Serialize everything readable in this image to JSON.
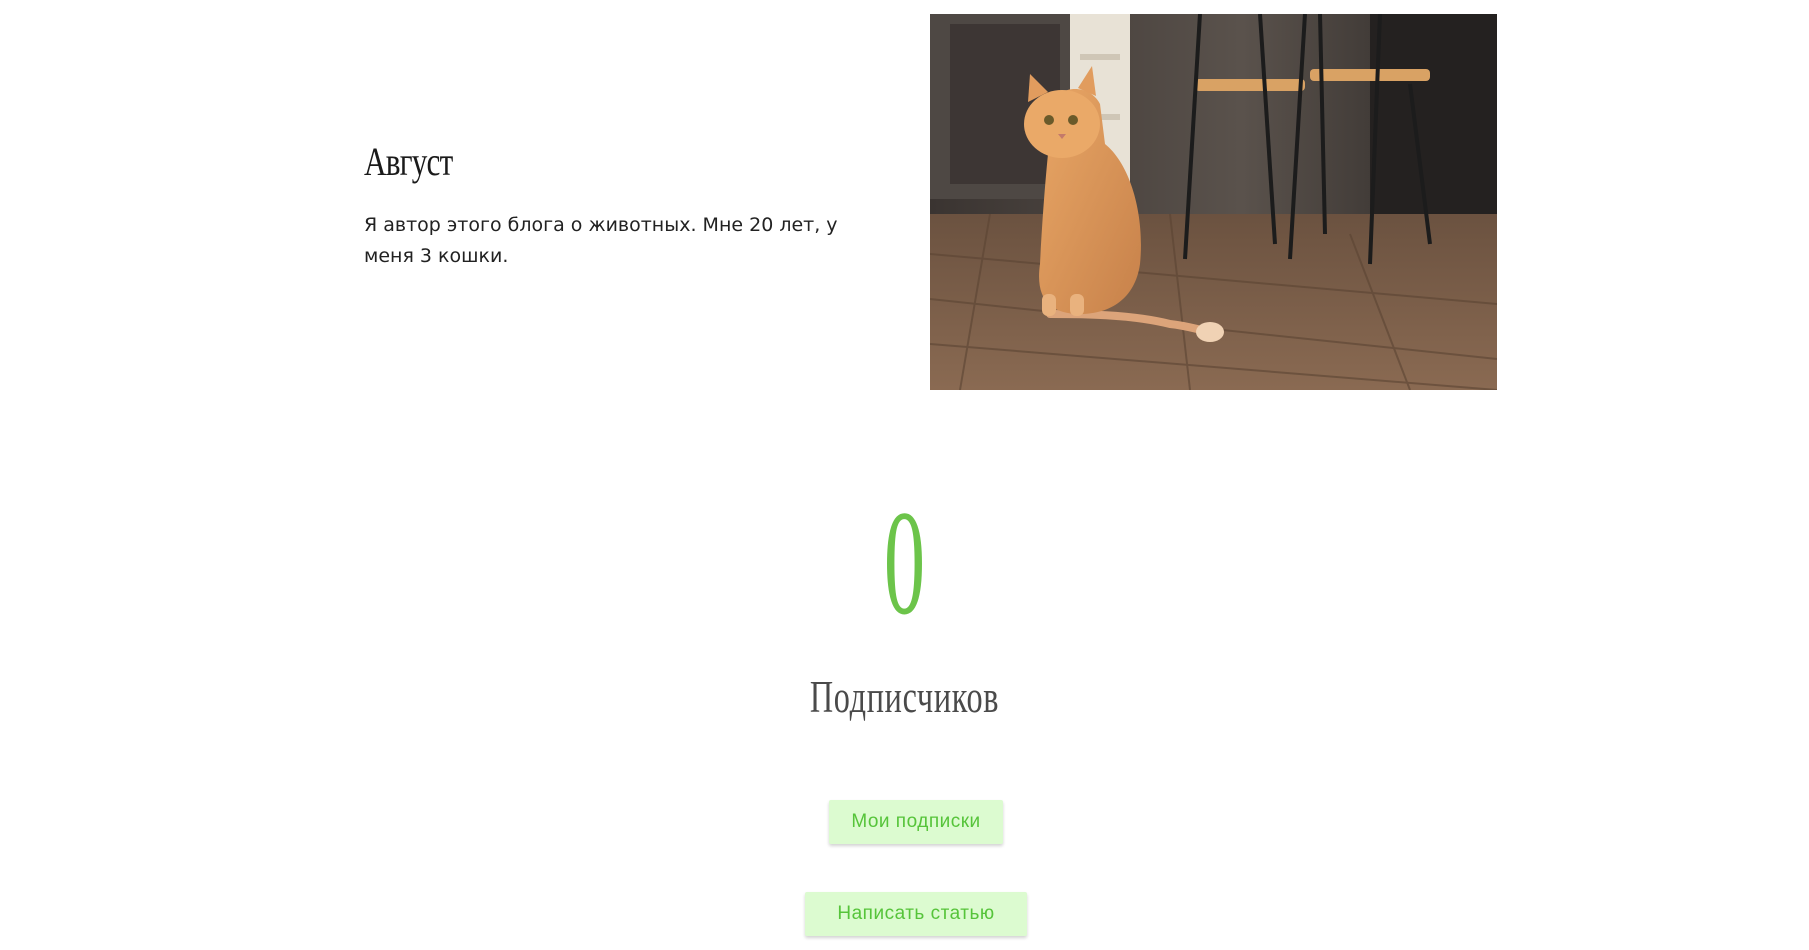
{
  "profile": {
    "name": "Август",
    "bio": "Я автор этого блога о животных. Мне 20 лет, у меня 3 кошки.",
    "photo_icon": "cat-photo"
  },
  "stats": {
    "subscriber_count": "0",
    "subscriber_label": "Подписчиков"
  },
  "actions": {
    "my_subscriptions_label": "Мои подписки",
    "write_article_label": "Написать статью"
  },
  "colors": {
    "accent": "#6cc44a",
    "button_bg": "#dcfbd0",
    "button_text": "#56c43a"
  }
}
